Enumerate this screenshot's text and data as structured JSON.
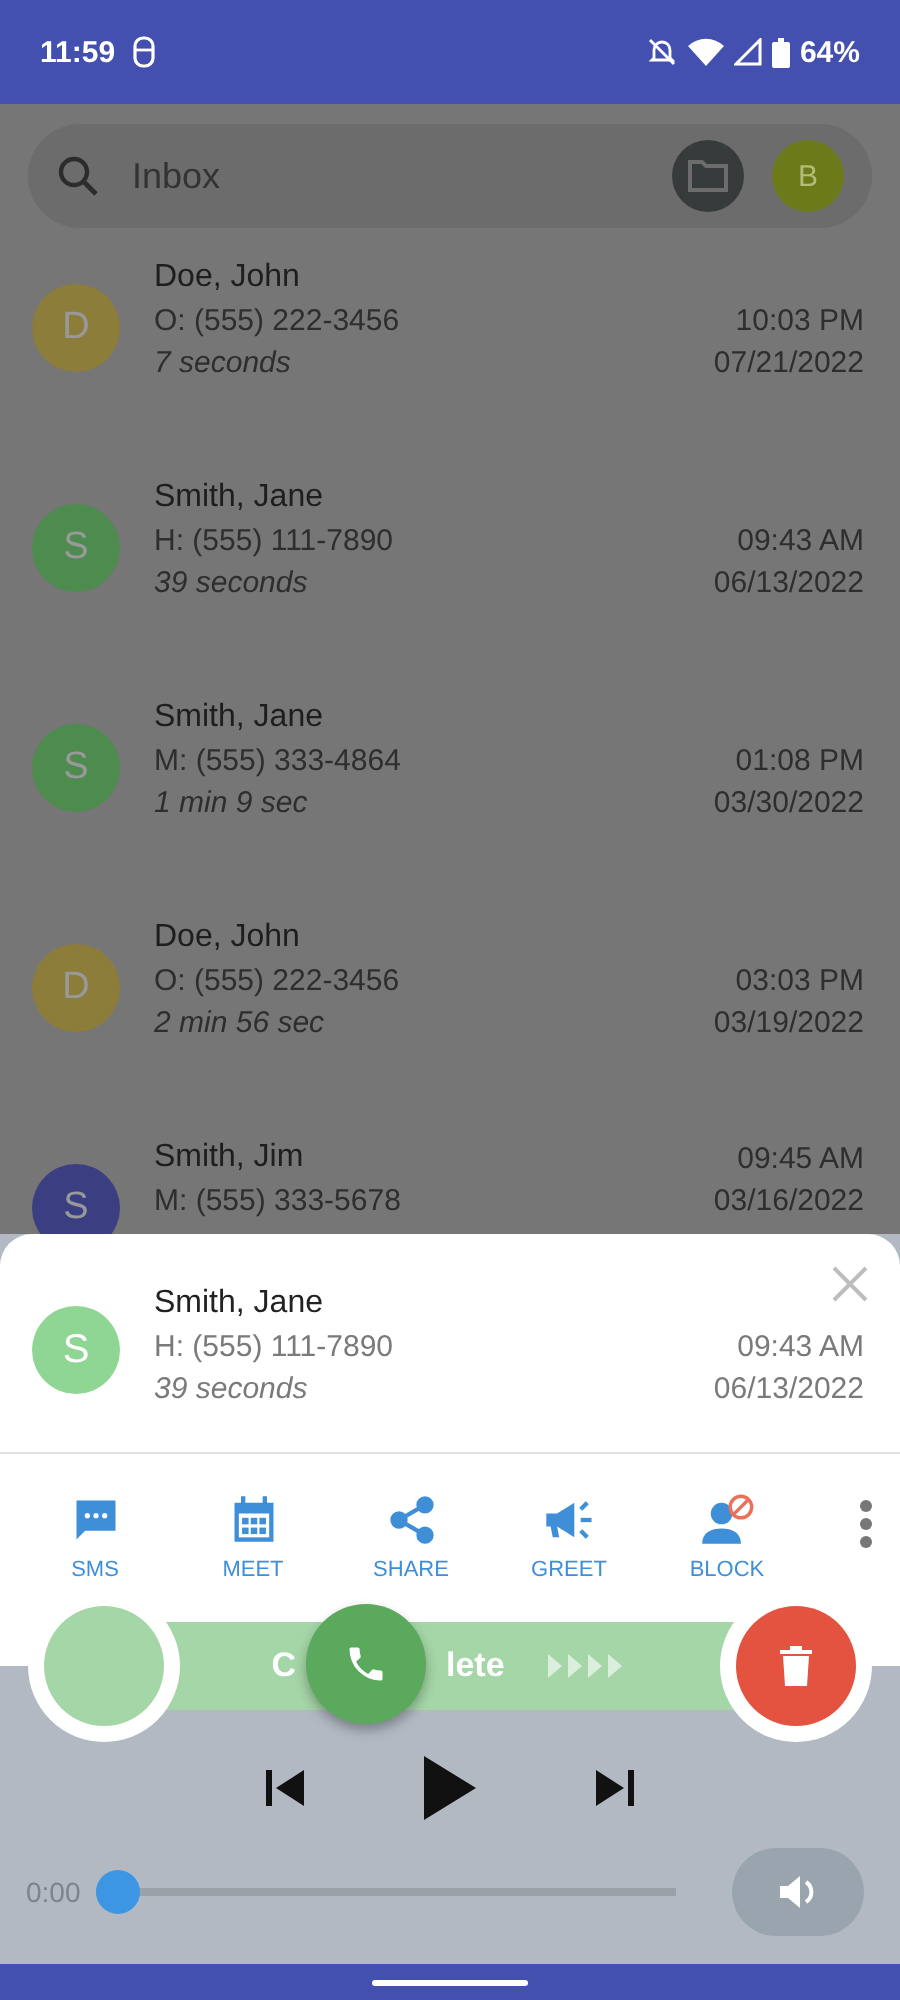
{
  "status_bar": {
    "time": "11:59",
    "battery": "64%"
  },
  "search": {
    "placeholder": "Inbox",
    "account_initial": "B"
  },
  "messages": [
    {
      "initial": "D",
      "color": "#8c7d3a",
      "name": "Doe, John",
      "phone": "O: (555) 222-3456",
      "duration": "7 seconds",
      "time": "10:03 PM",
      "date": "07/21/2022"
    },
    {
      "initial": "S",
      "color": "#4e8b4e",
      "name": "Smith, Jane",
      "phone": "H: (555) 111-7890",
      "duration": "39 seconds",
      "time": "09:43 AM",
      "date": "06/13/2022"
    },
    {
      "initial": "S",
      "color": "#4e8b4e",
      "name": "Smith, Jane",
      "phone": "M: (555) 333-4864",
      "duration": "1 min 9 sec",
      "time": "01:08 PM",
      "date": "03/30/2022"
    },
    {
      "initial": "D",
      "color": "#8c7d3a",
      "name": "Doe, John",
      "phone": "O: (555) 222-3456",
      "duration": "2 min 56 sec",
      "time": "03:03 PM",
      "date": "03/19/2022"
    },
    {
      "initial": "S",
      "color": "#3b3f82",
      "name": "Smith, Jim",
      "phone": "M: (555) 333-5678",
      "time": "09:45 AM",
      "date": "03/16/2022"
    }
  ],
  "detail": {
    "initial": "S",
    "color": "#8fd694",
    "name": "Smith, Jane",
    "phone": "H: (555) 111-7890",
    "duration": "39 seconds",
    "time": "09:43 AM",
    "date": "06/13/2022",
    "actions": [
      {
        "kind": "sms",
        "label": "SMS"
      },
      {
        "kind": "meet",
        "label": "MEET"
      },
      {
        "kind": "share",
        "label": "SHARE"
      },
      {
        "kind": "greet",
        "label": "GREET"
      },
      {
        "kind": "block",
        "label": "BLOCK"
      }
    ],
    "swipe_label_parts": [
      "C",
      "lete"
    ],
    "player": {
      "elapsed": "0:00",
      "level": 0
    }
  }
}
